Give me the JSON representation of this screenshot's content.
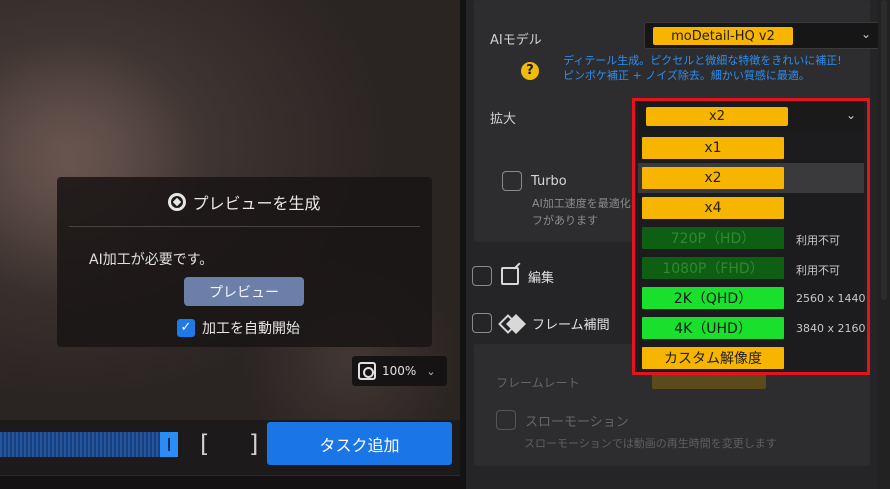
{
  "preview": {
    "generate_title": "プレビューを生成",
    "message": "AI加工が必要です。",
    "preview_button": "プレビュー",
    "auto_start_label": "加工を自動開始",
    "auto_start_checked": true,
    "zoom_level": "100%"
  },
  "bottom": {
    "brackets": "[ ]",
    "add_task_button": "タスク追加"
  },
  "settings": {
    "ai_model_label": "AIモデル",
    "ai_model_value": "moDetail-HQ  v2",
    "ai_model_description_line1": "ディテール生成。ピクセルと微細な特徴をきれいに補正!",
    "ai_model_description_line2": "ピンボケ補正 + ノイズ除去。細かい質感に最適。",
    "help_icon": "?",
    "upscale_label": "拡大",
    "upscale_value": "x2",
    "turbo_label": "Turbo",
    "turbo_checked": false,
    "turbo_desc_line1": "AI加工速度を最適化",
    "turbo_desc_line2": "フがあります",
    "edit_label": "編集",
    "frame_interp_label": "フレーム補間",
    "frame_rate_label": "フレームレート",
    "slowmo_label": "スローモーション",
    "slowmo_desc": "スローモーションでは動画の再生時間を変更します"
  },
  "dropdown": {
    "selected": "x2",
    "options": [
      {
        "label": "x1",
        "note": "",
        "color": "#f7b500",
        "text_color": "#222222",
        "hover": false
      },
      {
        "label": "x2",
        "note": "",
        "color": "#f7b500",
        "text_color": "#222222",
        "hover": true
      },
      {
        "label": "x4",
        "note": "",
        "color": "#f7b500",
        "text_color": "#222222",
        "hover": false
      },
      {
        "label": "720P（HD）",
        "note": "利用不可",
        "color": "#0e5e14",
        "text_color": "#2f8a2f",
        "hover": false
      },
      {
        "label": "1080P（FHD）",
        "note": "利用不可",
        "color": "#0e5e14",
        "text_color": "#2f8a2f",
        "hover": false
      },
      {
        "label": "2K（QHD）",
        "note": "2560 x 1440",
        "color": "#19e02c",
        "text_color": "#1a1a1a",
        "hover": false
      },
      {
        "label": "4K（UHD）",
        "note": "3840 x 2160",
        "color": "#19e02c",
        "text_color": "#1a1a1a",
        "hover": false
      },
      {
        "label": "カスタム解像度",
        "note": "",
        "color": "#f7b500",
        "text_color": "#222222",
        "hover": false
      }
    ]
  },
  "colors": {
    "accent_blue": "#1a75e6",
    "pill_yellow": "#f7b500",
    "highlight_red": "#e3141b"
  }
}
